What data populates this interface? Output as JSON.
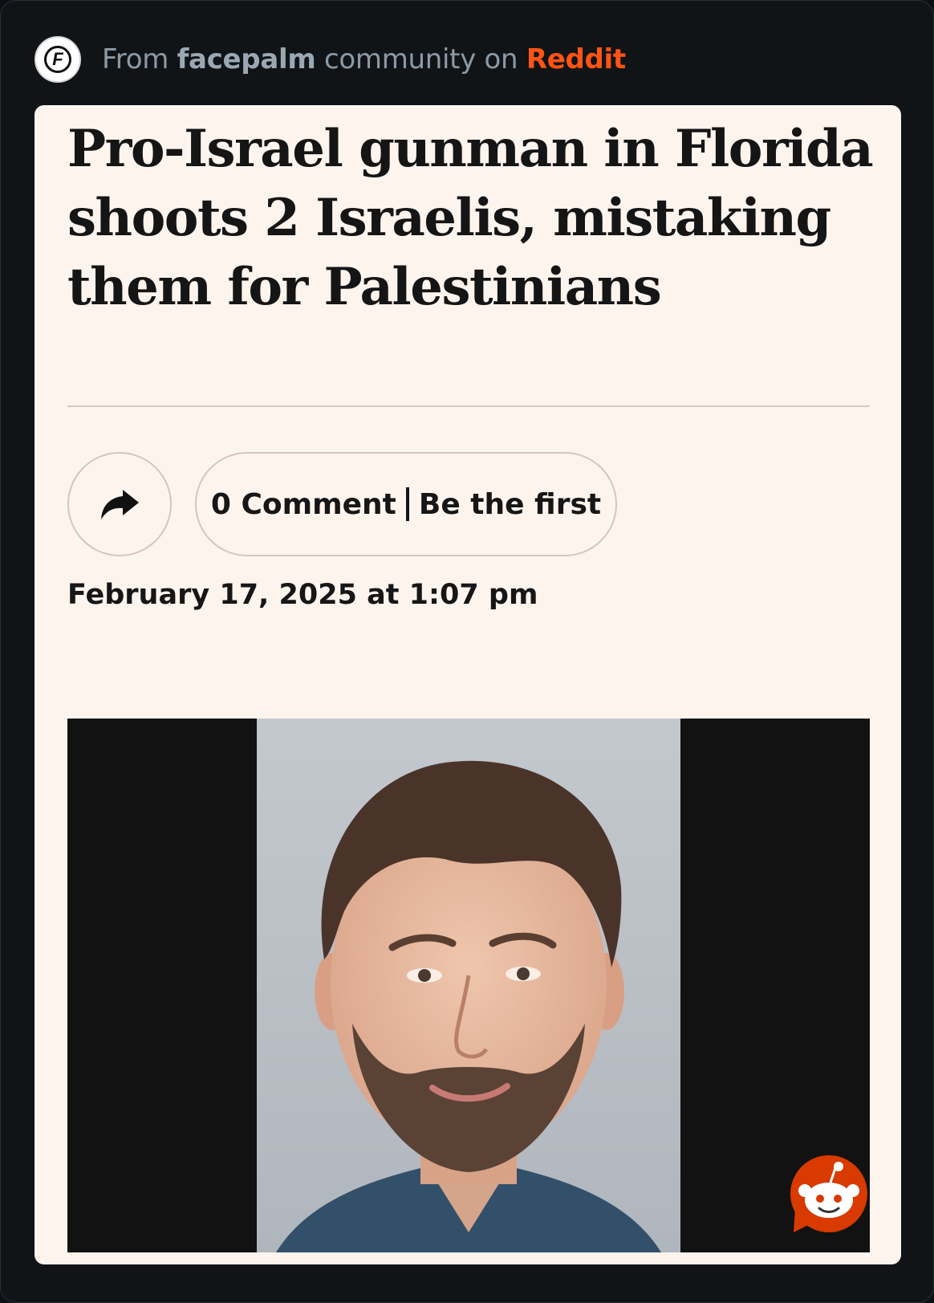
{
  "header": {
    "prefix": "From",
    "community": "facepalm",
    "middle": "community on",
    "platform": "Reddit",
    "avatar_letter": "F"
  },
  "article": {
    "headline": "Pro-Israel gunman in Florida shoots 2 Israelis, mistaking them for Palestinians",
    "share_icon": "share-arrow-icon",
    "comments_count": "0 Comment",
    "comments_cta": "Be the first",
    "date": "February 17, 2025 at 1:07 pm",
    "photo_icon": "mugshot-photo"
  },
  "colors": {
    "page_bg": "#111417",
    "card_bg": "#fdf4ee",
    "reddit_orange": "#ff5414",
    "header_text": "#8c9aa6",
    "headline_text": "#151515"
  }
}
